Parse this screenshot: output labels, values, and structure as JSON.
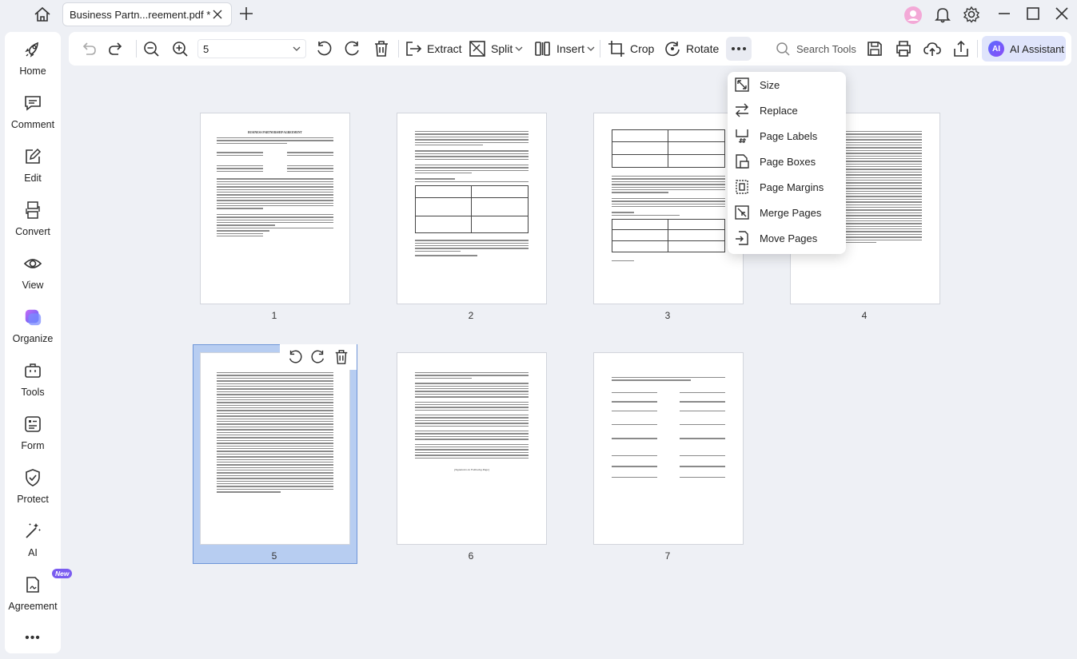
{
  "titlebar": {
    "tab_title": "Business Partn...reement.pdf *"
  },
  "sidebar": {
    "items": [
      {
        "label": "Home",
        "icon": "rocket-icon"
      },
      {
        "label": "Comment",
        "icon": "comment-icon"
      },
      {
        "label": "Edit",
        "icon": "edit-icon"
      },
      {
        "label": "Convert",
        "icon": "convert-icon"
      },
      {
        "label": "View",
        "icon": "eye-icon"
      },
      {
        "label": "Organize",
        "icon": "organize-icon"
      },
      {
        "label": "Tools",
        "icon": "toolbox-icon"
      },
      {
        "label": "Form",
        "icon": "form-icon"
      },
      {
        "label": "Protect",
        "icon": "shield-icon"
      },
      {
        "label": "AI",
        "icon": "magic-wand-icon"
      },
      {
        "label": "Agreement",
        "icon": "agreement-icon"
      }
    ],
    "new_badge": "New",
    "more": "•••"
  },
  "toolbar": {
    "page_value": "5",
    "extract": "Extract",
    "split": "Split",
    "insert": "Insert",
    "crop": "Crop",
    "rotate": "Rotate",
    "search_placeholder": "Search Tools",
    "ai_assistant": "AI Assistant",
    "ai_logo": "AI"
  },
  "dropdown": {
    "items": [
      "Size",
      "Replace",
      "Page Labels",
      "Page Boxes",
      "Page Margins",
      "Merge Pages",
      "Move Pages"
    ]
  },
  "pages": {
    "numbers": [
      "1",
      "2",
      "3",
      "4",
      "5",
      "6",
      "7"
    ],
    "selected": "5",
    "p1_title": "BUSINESS PARTNERSHIP AGREEMENT",
    "p6_sig": "[Signatures on Following Page]"
  },
  "colors": {
    "accent": "#2f6fe0",
    "selection": "#b7cdf1",
    "ai_button": "#dfe4fb",
    "badge": "#7a5cf0"
  }
}
